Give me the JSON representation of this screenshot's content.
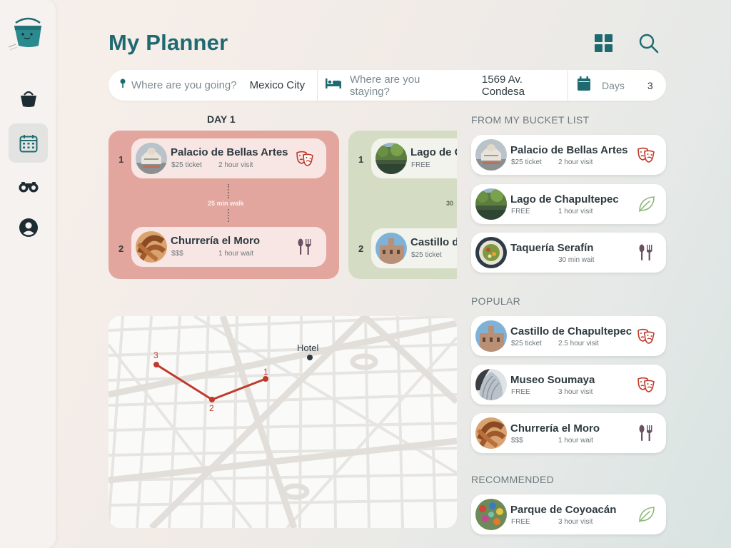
{
  "app": {
    "title": "My Planner"
  },
  "colors": {
    "accent": "#1f6a70",
    "day1": "#e3a69f",
    "day2": "#d4dcc4",
    "route": "#c0392b",
    "culture_icon": "#c0392b",
    "food_icon": "#6b5060",
    "nature_icon": "#8fb77c"
  },
  "sidebar": {
    "items": [
      {
        "icon": "bucket-icon"
      },
      {
        "icon": "calendar-icon",
        "active": true
      },
      {
        "icon": "binoculars-icon"
      },
      {
        "icon": "user-account-icon"
      }
    ]
  },
  "header": {
    "grid_icon": "grid-view-icon",
    "search_icon": "search-icon"
  },
  "search": {
    "destination": {
      "icon": "location-pin-icon",
      "placeholder": "Where are you going?",
      "value": "Mexico City"
    },
    "stay": {
      "icon": "bed-icon",
      "placeholder": "Where are you staying?",
      "value": "1569 Av. Condesa"
    },
    "days": {
      "icon": "calendar-icon",
      "label": "Days",
      "value": "3"
    }
  },
  "days": [
    {
      "label": "DAY 1",
      "stops": [
        {
          "num": "1",
          "name": "Palacio de Bellas Artes",
          "meta1": "$25 ticket",
          "meta2": "2 hour visit",
          "category": "culture"
        },
        {
          "num": "2",
          "name": "Churrería el Moro",
          "meta1": "$$$",
          "meta2": "1 hour wait",
          "category": "food"
        }
      ],
      "walk": "25 min walk"
    },
    {
      "label": "",
      "stops": [
        {
          "num": "1",
          "name": "Lago de Chapultepec",
          "meta1": "FREE",
          "meta2": "",
          "category": "nature"
        },
        {
          "num": "2",
          "name": "Castillo de Chapultepec",
          "meta1": "$25 ticket",
          "meta2": "",
          "category": "culture"
        }
      ],
      "walk": "30"
    }
  ],
  "map": {
    "hotel_label": "Hotel",
    "route_points": [
      "1",
      "2",
      "3"
    ]
  },
  "bucket_list": {
    "title": "FROM MY BUCKET LIST",
    "items": [
      {
        "name": "Palacio de Bellas Artes",
        "meta1": "$25 ticket",
        "meta2": "2 hour visit",
        "category": "culture"
      },
      {
        "name": "Lago de Chapultepec",
        "meta1": "FREE",
        "meta2": "1 hour visit",
        "category": "nature"
      },
      {
        "name": "Taquería Serafín",
        "meta1": "",
        "meta2": "30 min wait",
        "category": "food"
      }
    ]
  },
  "popular": {
    "title": "POPULAR",
    "items": [
      {
        "name": "Castillo de Chapultepec",
        "meta1": "$25 ticket",
        "meta2": "2.5 hour visit",
        "category": "culture"
      },
      {
        "name": "Museo Soumaya",
        "meta1": "FREE",
        "meta2": "3 hour visit",
        "category": "culture"
      },
      {
        "name": "Churrería el Moro",
        "meta1": "$$$",
        "meta2": "1 hour wait",
        "category": "food"
      }
    ]
  },
  "recommended": {
    "title": "RECOMMENDED",
    "items": [
      {
        "name": "Parque de Coyoacán",
        "meta1": "FREE",
        "meta2": "3 hour visit",
        "category": "nature"
      }
    ]
  }
}
